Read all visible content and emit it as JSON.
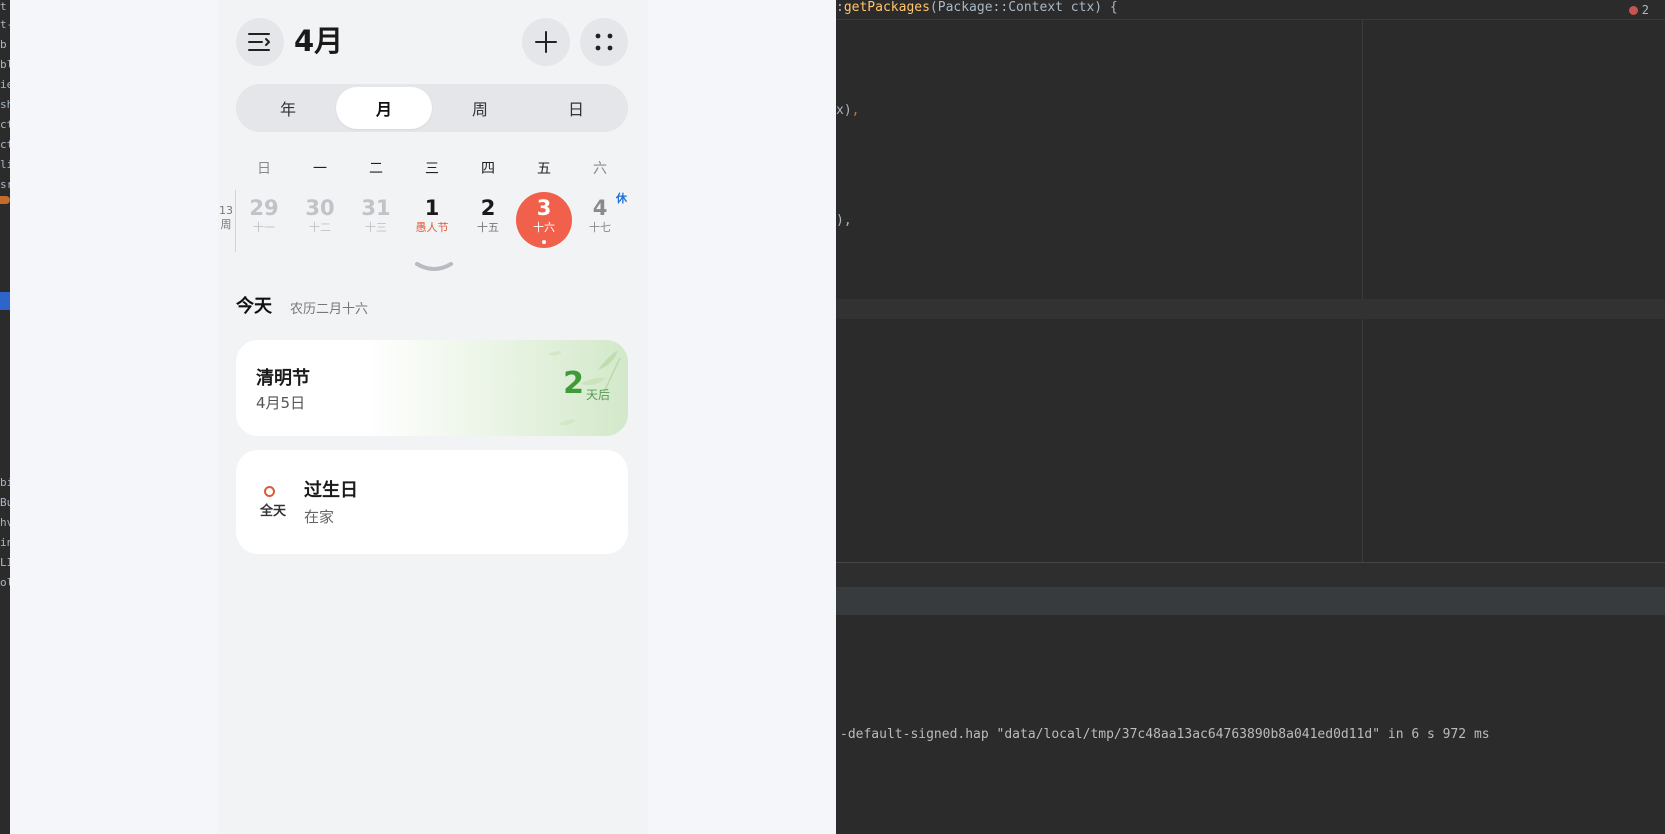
{
  "left_strip": {
    "fragments": [
      "t",
      "t-",
      "b",
      "bl",
      "ie",
      "sh",
      "ct",
      "ct",
      "lil",
      "sr",
      "bi",
      "Bu",
      "hv",
      "in",
      "LI",
      "ol"
    ]
  },
  "calendar": {
    "month_title": "4月",
    "view_tabs": [
      {
        "label": "年",
        "active": false
      },
      {
        "label": "月",
        "active": true
      },
      {
        "label": "周",
        "active": false
      },
      {
        "label": "日",
        "active": false
      }
    ],
    "weekdays": [
      "日",
      "一",
      "二",
      "三",
      "四",
      "五",
      "六"
    ],
    "week_number": "13",
    "week_suffix": "周",
    "days": [
      {
        "num": "29",
        "lunar": "十一",
        "state": "other"
      },
      {
        "num": "30",
        "lunar": "十二",
        "state": "other"
      },
      {
        "num": "31",
        "lunar": "十三",
        "state": "other"
      },
      {
        "num": "1",
        "lunar": "愚人节",
        "state": "holiday"
      },
      {
        "num": "2",
        "lunar": "十五",
        "state": "normal"
      },
      {
        "num": "3",
        "lunar": "十六",
        "state": "today"
      },
      {
        "num": "4",
        "lunar": "十七",
        "state": "sat"
      }
    ],
    "rest_tag": "休",
    "today_label": "今天",
    "today_lunar": "农历二月十六",
    "events": {
      "festival": {
        "title": "清明节",
        "date": "4月5日",
        "countdown": "2",
        "countdown_unit": "天后"
      },
      "birthday": {
        "allday": "全天",
        "title": "过生日",
        "location": "在家"
      }
    },
    "accent_color": "#f0604a"
  },
  "ide": {
    "signature_prefix": ":",
    "signature_fn": "getPackages",
    "signature_rest": "(Package::Context ctx) {",
    "line_a": "x)",
    "line_a_comma": ",",
    "line_b": "),",
    "error_count": "2",
    "log_text": "-default-signed.hap \"data/local/tmp/37c48aa13ac64763890b8a041ed0d11d\" in 6 s 972 ms"
  }
}
